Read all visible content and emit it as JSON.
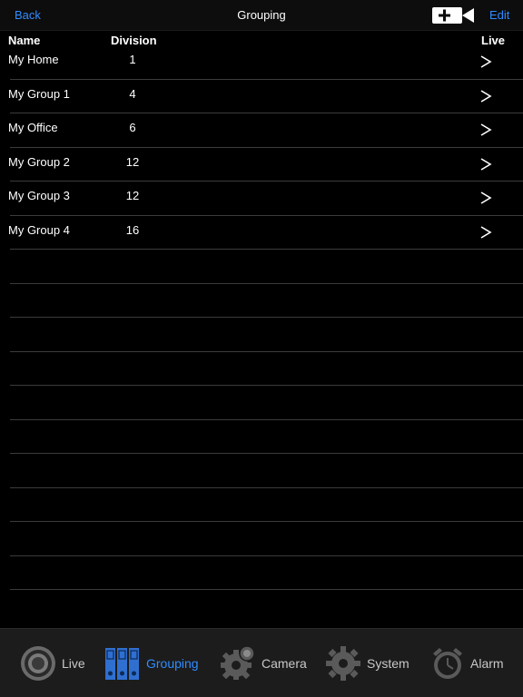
{
  "navbar": {
    "back_label": "Back",
    "title": "Grouping",
    "add_camera_icon": "video-camera-plus-icon",
    "edit_label": "Edit"
  },
  "columns": {
    "name": "Name",
    "division": "Division",
    "live": "Live"
  },
  "rows": [
    {
      "name": "My Home",
      "division": "1",
      "live_icon": ">"
    },
    {
      "name": "My Group 1",
      "division": "4",
      "live_icon": ">"
    },
    {
      "name": "My Office",
      "division": "6",
      "live_icon": ">"
    },
    {
      "name": "My Group 2",
      "division": "12",
      "live_icon": ">"
    },
    {
      "name": "My Group 3",
      "division": "12",
      "live_icon": ">"
    },
    {
      "name": "My Group 4",
      "division": "16",
      "live_icon": ">"
    }
  ],
  "tabbar": {
    "tabs": [
      {
        "label": "Live",
        "icon": "live-lens-icon",
        "active": false
      },
      {
        "label": "Grouping",
        "icon": "grouping-binders-icon",
        "active": true
      },
      {
        "label": "Camera",
        "icon": "camera-gear-icon",
        "active": false
      },
      {
        "label": "System",
        "icon": "system-gear-icon",
        "active": false
      },
      {
        "label": "Alarm",
        "icon": "alarm-clock-icon",
        "active": false
      }
    ]
  },
  "colors": {
    "accent": "#2f8cff",
    "background": "#000000",
    "separator": "#3b3b3b",
    "tabbar": "#1c1c1c"
  }
}
